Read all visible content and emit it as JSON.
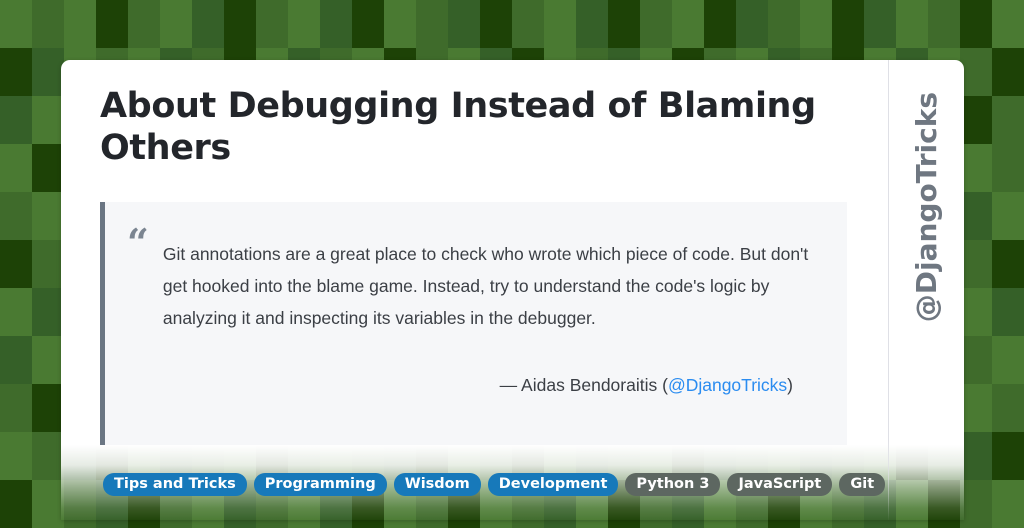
{
  "background": {
    "base_color": "#3f6b2b",
    "palette": [
      "#4a7a32",
      "#3f6b2b",
      "#356028",
      "#1d4206",
      "#2f5a22",
      "#51813a"
    ],
    "cells": [
      [
        0,
        1,
        0,
        3,
        1,
        0,
        2,
        3,
        1,
        0,
        2,
        3,
        0,
        1,
        2,
        3,
        1,
        0,
        2,
        3,
        1,
        0,
        3,
        2,
        1,
        0,
        3,
        2,
        0,
        1,
        3,
        0
      ],
      [
        3,
        2,
        0,
        1,
        0,
        2,
        1,
        3,
        0,
        2,
        1,
        0,
        3,
        1,
        0,
        2,
        3,
        0,
        1,
        2,
        0,
        3,
        1,
        0,
        2,
        1,
        3,
        0,
        2,
        0,
        1,
        3
      ],
      [
        2,
        0,
        1,
        3,
        0,
        1,
        2,
        0,
        3,
        1,
        0,
        2,
        1,
        3,
        0,
        1,
        2,
        3,
        0,
        1,
        3,
        2,
        0,
        1,
        0,
        3,
        2,
        1,
        0,
        2,
        3,
        1
      ],
      [
        0,
        3,
        2,
        1,
        3,
        0,
        1,
        2,
        0,
        3,
        2,
        1,
        0,
        2,
        3,
        0,
        1,
        2,
        3,
        0,
        1,
        0,
        2,
        3,
        1,
        0,
        2,
        3,
        1,
        2,
        0,
        1
      ],
      [
        1,
        0,
        3,
        2,
        0,
        1,
        3,
        2,
        1,
        0,
        2,
        3,
        1,
        0,
        1,
        3,
        0,
        2,
        1,
        3,
        0,
        2,
        3,
        1,
        0,
        2,
        1,
        0,
        3,
        1,
        2,
        0
      ],
      [
        3,
        1,
        0,
        2,
        1,
        3,
        0,
        1,
        2,
        0,
        3,
        1,
        2,
        0,
        3,
        1,
        2,
        0,
        1,
        2,
        3,
        0,
        1,
        2,
        3,
        0,
        1,
        3,
        0,
        2,
        1,
        3
      ],
      [
        0,
        2,
        1,
        0,
        3,
        2,
        1,
        0,
        1,
        3,
        0,
        2,
        0,
        1,
        2,
        3,
        0,
        3,
        2,
        1,
        0,
        1,
        3,
        0,
        2,
        1,
        0,
        2,
        1,
        3,
        0,
        2
      ],
      [
        2,
        0,
        3,
        1,
        0,
        1,
        2,
        3,
        0,
        2,
        1,
        0,
        3,
        2,
        0,
        1,
        3,
        1,
        0,
        2,
        1,
        3,
        0,
        2,
        0,
        1,
        3,
        0,
        2,
        0,
        1,
        0
      ],
      [
        1,
        3,
        0,
        2,
        1,
        0,
        3,
        1,
        2,
        0,
        3,
        2,
        1,
        0,
        1,
        2,
        0,
        3,
        1,
        0,
        2,
        0,
        1,
        3,
        1,
        0,
        2,
        1,
        3,
        2,
        0,
        1
      ],
      [
        0,
        1,
        2,
        3,
        0,
        2,
        1,
        0,
        3,
        1,
        0,
        1,
        2,
        3,
        0,
        1,
        3,
        0,
        2,
        1,
        0,
        3,
        2,
        1,
        0,
        2,
        1,
        0,
        3,
        1,
        2,
        3
      ],
      [
        3,
        0,
        1,
        2,
        3,
        1,
        0,
        2,
        1,
        0,
        2,
        3,
        0,
        1,
        3,
        0,
        1,
        2,
        0,
        3,
        1,
        2,
        0,
        1,
        3,
        0,
        1,
        2,
        0,
        3,
        1,
        0
      ]
    ]
  },
  "card": {
    "title": "About Debugging Instead of Blaming Others",
    "quote": {
      "mark": "“",
      "text": "Git annotations are a great place to check who wrote which piece of code. But don't get hooked into the blame game. Instead, try to understand the code's logic by analyzing it and inspecting its variables in the debugger.",
      "attribution_dash": "— Aidas Bendoraitis (",
      "attribution_handle": "@DjangoTricks",
      "attribution_close": ")"
    },
    "vertical_handle": "@DjangoTricks"
  },
  "tags": [
    {
      "label": "Tips and Tricks",
      "style": "primary"
    },
    {
      "label": "Programming",
      "style": "primary"
    },
    {
      "label": "Wisdom",
      "style": "primary"
    },
    {
      "label": "Development",
      "style": "primary"
    },
    {
      "label": "Python 3",
      "style": "secondary"
    },
    {
      "label": "JavaScript",
      "style": "secondary"
    },
    {
      "label": "Git",
      "style": "secondary"
    }
  ],
  "colors": {
    "primary_tag": "#1779ba",
    "secondary_tag": "#5d6761",
    "link": "#2a8cf0",
    "title": "#23262b",
    "quote_border": "#6b7683",
    "quote_bg": "#f6f7f9"
  }
}
